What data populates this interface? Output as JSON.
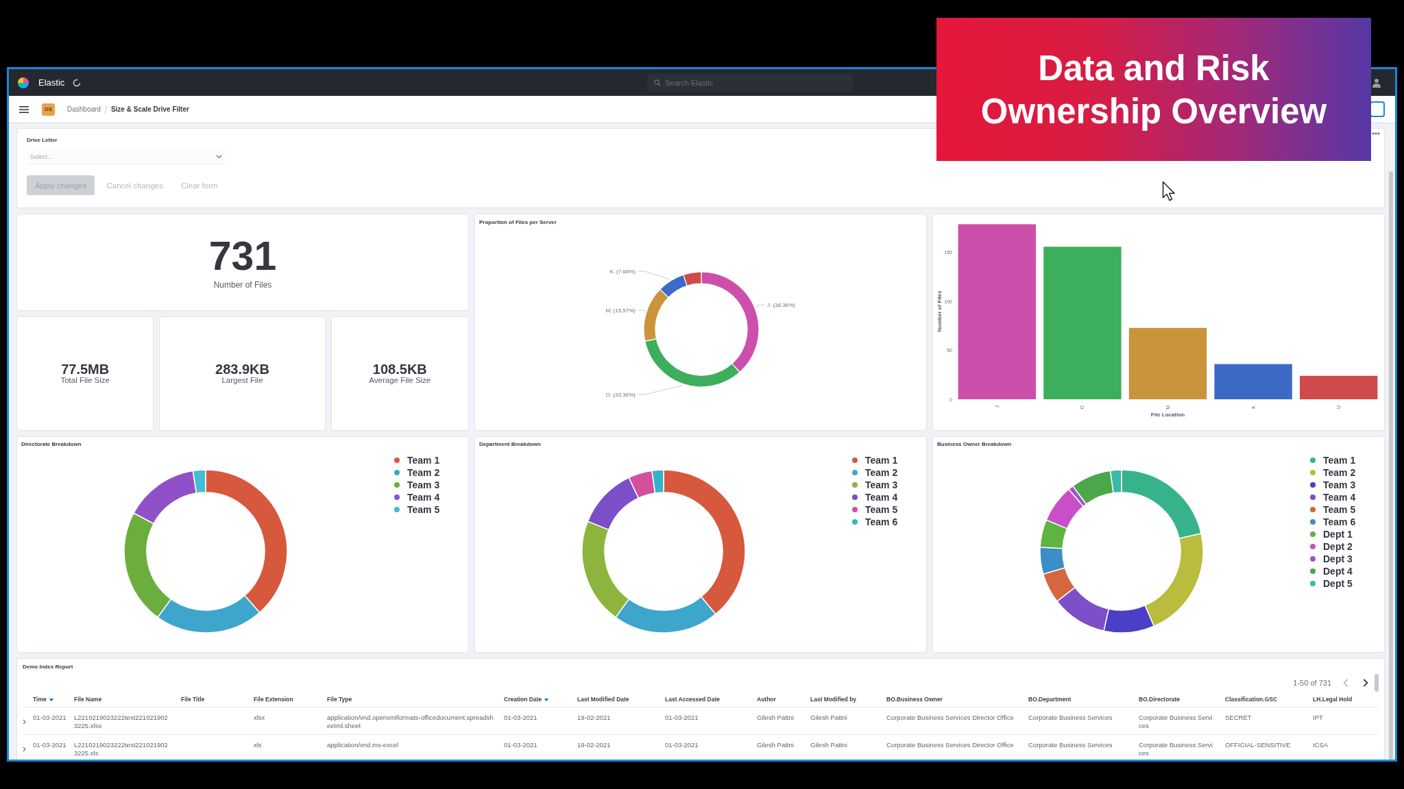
{
  "title_banner": {
    "text": "Data and Risk Ownership Overview"
  },
  "top_bar": {
    "brand": "Elastic",
    "search": {
      "placeholder": "Search Elastic"
    }
  },
  "breadcrumb": {
    "badge": "DS",
    "items": [
      {
        "label": "Dashboard",
        "selected": false
      },
      {
        "label": "Size & Scale Drive Filter",
        "selected": true
      }
    ]
  },
  "filter_panel": {
    "field_label": "Drive Letter",
    "select": {
      "placeholder": "Select..."
    },
    "buttons": [
      {
        "label": "Apply changes",
        "kind": "fill",
        "disabled": true
      },
      {
        "label": "Cancel changes",
        "kind": "empty",
        "disabled": true
      },
      {
        "label": "Clear form",
        "kind": "empty",
        "disabled": true
      }
    ]
  },
  "file_count": {
    "value": "731",
    "label": "Number of Files"
  },
  "file_stats": [
    {
      "value": "77.5MB",
      "label": "Total File Size"
    },
    {
      "value": "283.9KB",
      "label": "Largest File"
    },
    {
      "value": "108.5KB",
      "label": "Average File Size"
    }
  ],
  "server_chart": {
    "chart_data": {
      "type": "donut",
      "title": "Proportion of Files per Server",
      "categories": [
        "J: (38.36%)",
        "O: (33.36%)",
        "M: (15.57%)",
        "K: (7.68%)",
        null
      ],
      "values": [
        38.36,
        33.36,
        15.57,
        7.68,
        5.03
      ],
      "colors": [
        "#cc4fab",
        "#3dae5b",
        "#c9943a",
        "#3c6ac5",
        "#d04a49"
      ]
    }
  },
  "location_chart": {
    "chart_data": {
      "type": "bar",
      "xlabel": "File Location",
      "ylabel": "Number of Files",
      "categories": [
        "J",
        "O",
        "M",
        "K",
        "U"
      ],
      "values": [
        179,
        156,
        73,
        36,
        24
      ],
      "colors": [
        "#cc4fab",
        "#3dae5b",
        "#c9943a",
        "#3c6ac5",
        "#d04a49"
      ],
      "ylim": [
        0,
        180
      ],
      "yticks": [
        0,
        50,
        100,
        150
      ]
    }
  },
  "breakdowns": [
    {
      "title": "Directorate Breakdown",
      "legend": [
        {
          "label": "Team 1",
          "color": "#d6593d"
        },
        {
          "label": "Team 2",
          "color": "#3ea6cc"
        },
        {
          "label": "Team 3",
          "color": "#6cae3e"
        },
        {
          "label": "Team 4",
          "color": "#9050c8"
        },
        {
          "label": "Team 5",
          "color": "#45bcd2"
        }
      ]
    },
    {
      "title": "Department Breakdown",
      "legend": [
        {
          "label": "Team 1",
          "color": "#d6593d"
        },
        {
          "label": "Team 2",
          "color": "#3ea6cc"
        },
        {
          "label": "Team 3",
          "color": "#8db43c"
        },
        {
          "label": "Team 4",
          "color": "#7a4fc8"
        },
        {
          "label": "Team 5",
          "color": "#d44f9e"
        },
        {
          "label": "Team 6",
          "color": "#36b3c8"
        }
      ]
    },
    {
      "title": "Business Owner Breakdown",
      "legend": [
        {
          "label": "Team 1",
          "color": "#36b38a"
        },
        {
          "label": "Team 2",
          "color": "#b9bc3c"
        },
        {
          "label": "Team 3",
          "color": "#4b3fc8"
        },
        {
          "label": "Team 4",
          "color": "#7b50c8"
        },
        {
          "label": "Team 5",
          "color": "#d6663d"
        },
        {
          "label": "Team 6",
          "color": "#3b8ec8"
        },
        {
          "label": "Dept 1",
          "color": "#5db43e"
        },
        {
          "label": "Dept 2",
          "color": "#c84fc8"
        },
        {
          "label": "Dept 3",
          "color": "#a352c8"
        },
        {
          "label": "Dept 4",
          "color": "#4aa84a"
        },
        {
          "label": "Dept 5",
          "color": "#3db8a8"
        }
      ]
    }
  ],
  "report": {
    "title": "Demo Index Report",
    "pagination": {
      "text": "1-50 of 731",
      "prev_disabled": true,
      "next_disabled": false
    },
    "columns": [
      {
        "label": "Time",
        "sorted": true
      },
      {
        "label": "File Name",
        "sorted": false
      },
      {
        "label": "File Title",
        "sorted": false
      },
      {
        "label": "File Extension",
        "sorted": false
      },
      {
        "label": "File Type",
        "sorted": false
      },
      {
        "label": "Creation Date",
        "sorted": true
      },
      {
        "label": "Last Modified Date",
        "sorted": false
      },
      {
        "label": "Last Accessed Date",
        "sorted": false
      },
      {
        "label": "Author",
        "sorted": false
      },
      {
        "label": "Last Modified by",
        "sorted": false
      },
      {
        "label": "BO.Business Owner",
        "sorted": false
      },
      {
        "label": "BO.Department",
        "sorted": false
      },
      {
        "label": "BO.Directorate",
        "sorted": false
      },
      {
        "label": "Classification.GSC",
        "sorted": false
      },
      {
        "label": "LH.Legal Hold",
        "sorted": false
      }
    ],
    "rows": [
      {
        "expanded": false,
        "cells": [
          "01-03-2021",
          "L2210219023222test2210219023225.xlsx",
          null,
          "xlsx",
          "application/vnd.openxmlformats-officedocument.spreadsheetml.sheet",
          "01-03-2021",
          "19-02-2021",
          "01-03-2021",
          "Gilesh Pattni",
          "Gilesh Pattni",
          "Corporate Business Services Director Office",
          "Corporate Business Services",
          "Corporate Business Services",
          "SECRET",
          "IPT"
        ]
      },
      {
        "expanded": false,
        "cells": [
          "01-03-2021",
          "L2210219023222test2210219023225.xls",
          null,
          "xls",
          "application/vnd.ms-excel",
          "01-03-2021",
          "19-02-2021",
          "01-03-2021",
          "Gilesh Pattni",
          "Gilesh Pattni",
          "Corporate Business Services Director Office",
          "Corporate Business Services",
          "Corporate Business Services",
          "OFFICIAL-SENSITIVE",
          "ICSA"
        ]
      }
    ]
  }
}
